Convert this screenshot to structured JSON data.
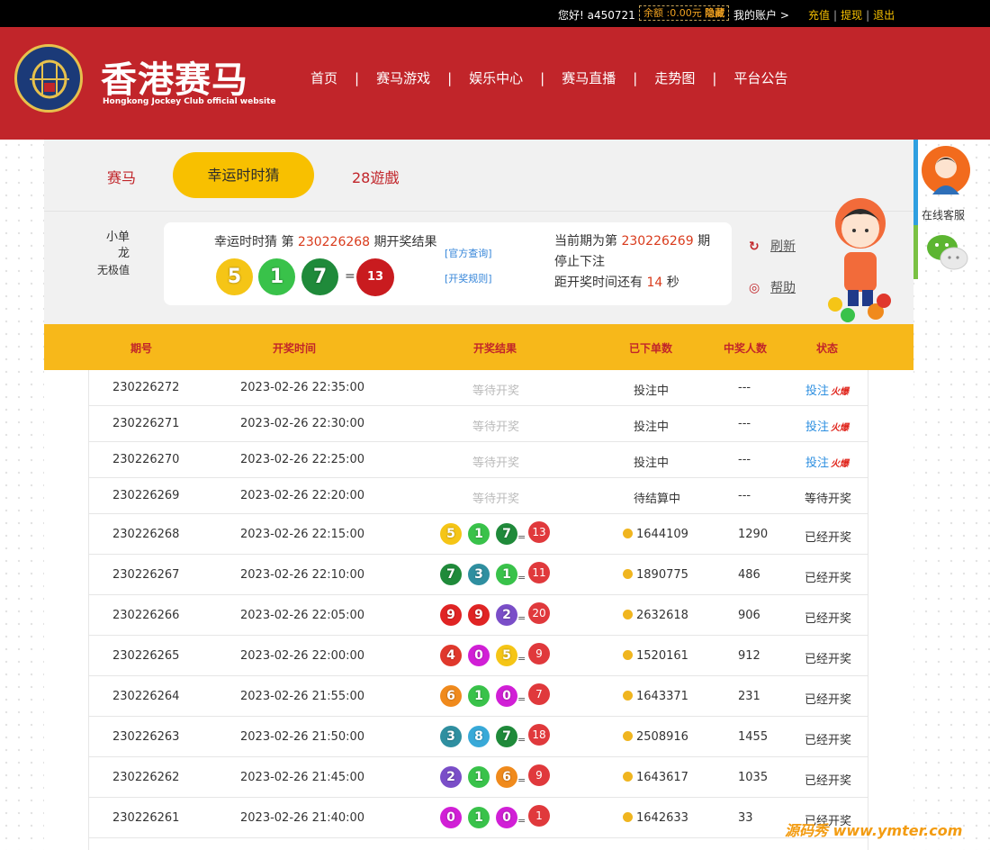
{
  "topbar": {
    "greeting": "您好! a450721",
    "balance_label": "余额 :0.00元",
    "balance_hide": "隐藏",
    "my_account": "我的账户 >",
    "links": [
      "充值",
      "提现",
      "退出"
    ]
  },
  "header": {
    "logo_title": "香港赛马",
    "logo_subtitle": "Hongkong Jockey Club official website",
    "nav": [
      "首页",
      "赛马游戏",
      "娱乐中心",
      "赛马直播",
      "走势图",
      "平台公告"
    ]
  },
  "tabs": [
    "赛马",
    "幸运时时猜",
    "28遊戲"
  ],
  "left_info": [
    "小单",
    "龙",
    "无极值"
  ],
  "result": {
    "title_prefix": "幸运时时猜 第",
    "issue": "230226268",
    "title_suffix": "期开奖结果",
    "balls": [
      "5",
      "1",
      "7"
    ],
    "eq": "=",
    "sum": "13",
    "link_official": "[官方查询]",
    "link_rules": "[开奖规则]",
    "current_prefix": "当前期为第",
    "current_issue": "230226269",
    "current_suffix": "期",
    "stop": "停止下注",
    "countdown_prefix": "距开奖时间还有",
    "countdown_value": "14",
    "countdown_suffix": "秒"
  },
  "actions": {
    "refresh": "刷新",
    "help": "帮助"
  },
  "table": {
    "headers": [
      "期号",
      "开奖时间",
      "开奖结果",
      "已下单数",
      "中奖人数",
      "状态"
    ],
    "rows": [
      {
        "issue": "230226272",
        "time": "2023-02-26 22:35:00",
        "result": "等待开奖",
        "orders": "投注中",
        "winners": "---",
        "status": "投注",
        "hot": "火爆"
      },
      {
        "issue": "230226271",
        "time": "2023-02-26 22:30:00",
        "result": "等待开奖",
        "orders": "投注中",
        "winners": "---",
        "status": "投注",
        "hot": "火爆"
      },
      {
        "issue": "230226270",
        "time": "2023-02-26 22:25:00",
        "result": "等待开奖",
        "orders": "投注中",
        "winners": "---",
        "status": "投注",
        "hot": "火爆"
      },
      {
        "issue": "230226269",
        "time": "2023-02-26 22:20:00",
        "result": "等待开奖",
        "orders": "待结算中",
        "winners": "---",
        "status": "等待开奖"
      },
      {
        "issue": "230226268",
        "time": "2023-02-26 22:15:00",
        "balls": [
          "5",
          "1",
          "7"
        ],
        "sum": "13",
        "orders": "1644109",
        "winners": "1290",
        "status": "已经开奖"
      },
      {
        "issue": "230226267",
        "time": "2023-02-26 22:10:00",
        "balls": [
          "7",
          "3",
          "1"
        ],
        "sum": "11",
        "orders": "1890775",
        "winners": "486",
        "status": "已经开奖"
      },
      {
        "issue": "230226266",
        "time": "2023-02-26 22:05:00",
        "balls": [
          "9",
          "9",
          "2"
        ],
        "sum": "20",
        "orders": "2632618",
        "winners": "906",
        "status": "已经开奖"
      },
      {
        "issue": "230226265",
        "time": "2023-02-26 22:00:00",
        "balls": [
          "4",
          "0",
          "5"
        ],
        "sum": "9",
        "orders": "1520161",
        "winners": "912",
        "status": "已经开奖"
      },
      {
        "issue": "230226264",
        "time": "2023-02-26 21:55:00",
        "balls": [
          "6",
          "1",
          "0"
        ],
        "sum": "7",
        "orders": "1643371",
        "winners": "231",
        "status": "已经开奖"
      },
      {
        "issue": "230226263",
        "time": "2023-02-26 21:50:00",
        "balls": [
          "3",
          "8",
          "7"
        ],
        "sum": "18",
        "orders": "2508916",
        "winners": "1455",
        "status": "已经开奖"
      },
      {
        "issue": "230226262",
        "time": "2023-02-26 21:45:00",
        "balls": [
          "2",
          "1",
          "6"
        ],
        "sum": "9",
        "orders": "1643617",
        "winners": "1035",
        "status": "已经开奖"
      },
      {
        "issue": "230226261",
        "time": "2023-02-26 21:40:00",
        "balls": [
          "0",
          "1",
          "0"
        ],
        "sum": "1",
        "orders": "1642633",
        "winners": "33",
        "status": "已经开奖"
      }
    ]
  },
  "ball_colors": {
    "0": "#d11fd6",
    "1": "#39c24a",
    "2": "#7a4ec8",
    "3": "#2f8fa0",
    "4": "#e0382c",
    "5": "#f5c516",
    "6": "#f08a1c",
    "7": "#1f8a3a",
    "8": "#38a9d8",
    "9": "#e02424"
  },
  "side": {
    "customer_service": "在线客服"
  },
  "watermark": "源码秀 www.ymter.com"
}
